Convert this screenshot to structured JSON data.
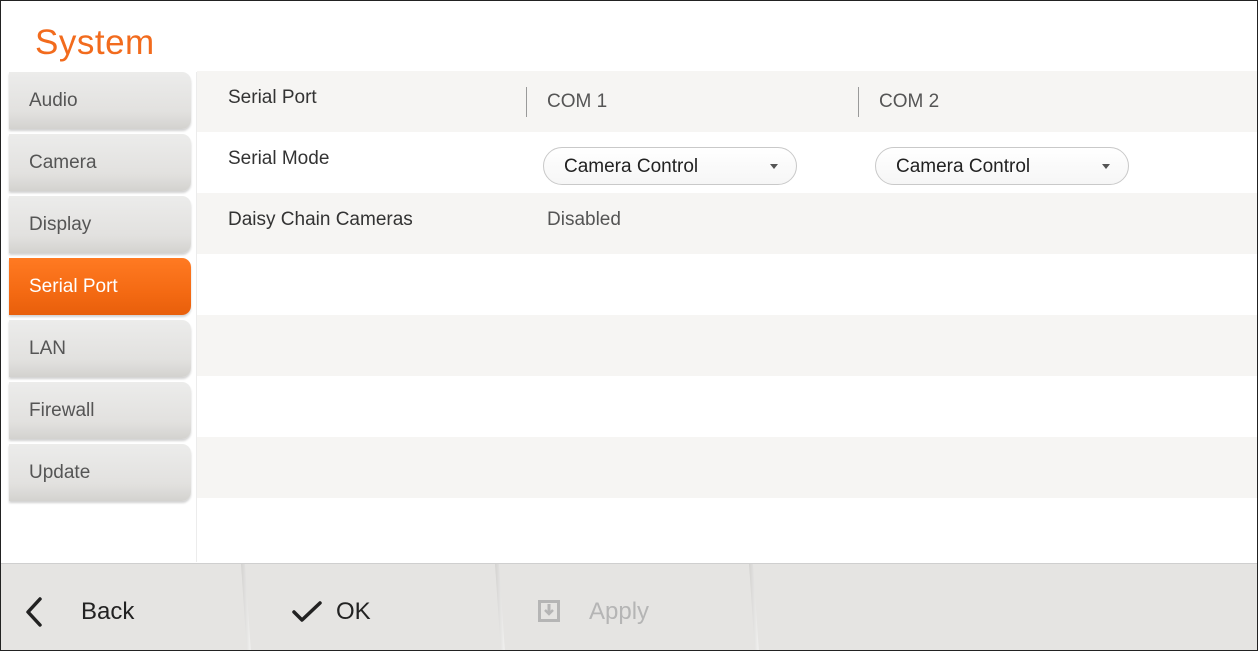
{
  "header": {
    "title": "System"
  },
  "sidebar": {
    "items": [
      {
        "label": "Audio",
        "active": false
      },
      {
        "label": "Camera",
        "active": false
      },
      {
        "label": "Display",
        "active": false
      },
      {
        "label": "Serial Port",
        "active": true
      },
      {
        "label": "LAN",
        "active": false
      },
      {
        "label": "Firewall",
        "active": false
      },
      {
        "label": "Update",
        "active": false
      }
    ]
  },
  "table": {
    "header": {
      "label": "Serial Port",
      "col1": "COM 1",
      "col2": "COM 2"
    },
    "serial_mode": {
      "label": "Serial Mode",
      "com1_value": "Camera Control",
      "com2_value": "Camera Control"
    },
    "daisy_chain": {
      "label": "Daisy Chain Cameras",
      "value": "Disabled"
    }
  },
  "footer": {
    "back_label": "Back",
    "ok_label": "OK",
    "apply_label": "Apply"
  },
  "colors": {
    "accent": "#f26b1d",
    "row_shade": "#f6f5f3",
    "footer_bg": "#e5e4e2",
    "disabled_text": "#b5b5b5"
  },
  "icons": {
    "back": "chevron-left-icon",
    "ok": "checkmark-icon",
    "apply": "apply-icon"
  }
}
